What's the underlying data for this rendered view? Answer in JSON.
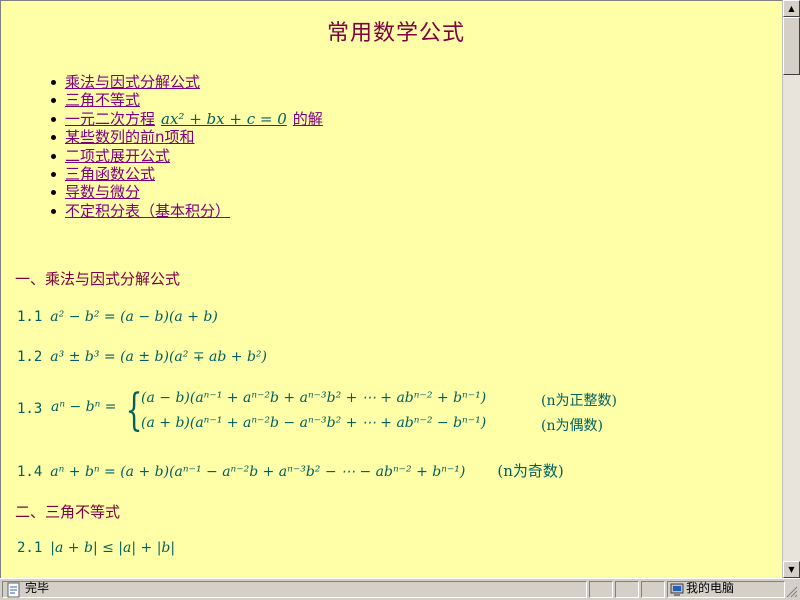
{
  "page": {
    "title": "常用数学公式",
    "toc": [
      {
        "label": "乘法与因式分解公式"
      },
      {
        "label": "三角不等式"
      },
      {
        "label_before": "一元二次方程",
        "math": "ax² + bx + c = 0",
        "label_after": "的解"
      },
      {
        "label": "某些数列的前n项和"
      },
      {
        "label": "二项式展开公式"
      },
      {
        "label": "三角函数公式"
      },
      {
        "label": "导数与微分"
      },
      {
        "label": "不定积分表（基本积分）"
      }
    ]
  },
  "sections": {
    "s1_title": "一、乘法与因式分解公式",
    "f1_1_num": "1.1",
    "f1_1": "a² − b² = (a − b)(a + b)",
    "f1_2_num": "1.2",
    "f1_2": "a³ ± b³ = (a ± b)(a² ∓ ab + b²)",
    "f1_3_num": "1.3",
    "f1_3_lhs": "aⁿ − bⁿ =",
    "f1_3_line1": "(a − b)(aⁿ⁻¹ + aⁿ⁻²b + aⁿ⁻³b² + ⋯ + abⁿ⁻² + bⁿ⁻¹)",
    "f1_3_note1": "(n为正整数)",
    "f1_3_line2": "(a + b)(aⁿ⁻¹ + aⁿ⁻²b − aⁿ⁻³b² + ⋯ + abⁿ⁻² − bⁿ⁻¹)",
    "f1_3_note2": "(n为偶数)",
    "f1_4_num": "1.4",
    "f1_4": "aⁿ + bⁿ = (a + b)(aⁿ⁻¹ − aⁿ⁻²b + aⁿ⁻³b² − ⋯ − abⁿ⁻² + bⁿ⁻¹)",
    "f1_4_note": "(n为奇数)",
    "s2_title": "二、三角不等式",
    "f2_1_num": "2.1",
    "f2_1": "|a + b| ≤ |a| + |b|"
  },
  "statusbar": {
    "status_text": "完毕",
    "zone_text": "我的电脑"
  },
  "colors": {
    "background": "#ffffa8",
    "heading": "#800040",
    "link": "#800080",
    "formula": "#006060"
  }
}
